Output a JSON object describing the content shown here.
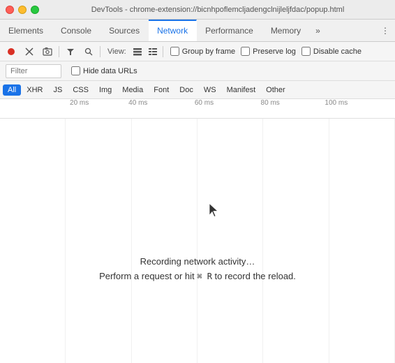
{
  "window": {
    "title": "DevTools - chrome-extension://bicnhpoflemcljadengclnijleljfdac/popup.html",
    "controls": {
      "close": "close",
      "minimize": "minimize",
      "maximize": "maximize"
    }
  },
  "tabs": [
    {
      "id": "elements",
      "label": "Elements",
      "active": false
    },
    {
      "id": "console",
      "label": "Console",
      "active": false
    },
    {
      "id": "sources",
      "label": "Sources",
      "active": false
    },
    {
      "id": "network",
      "label": "Network",
      "active": true
    },
    {
      "id": "performance",
      "label": "Performance",
      "active": false
    },
    {
      "id": "memory",
      "label": "Memory",
      "active": false
    }
  ],
  "toolbar": {
    "view_label": "View:",
    "group_by_frame_label": "Group by frame",
    "preserve_log_label": "Preserve log",
    "disable_cache_label": "Disable cache"
  },
  "filter": {
    "placeholder": "Filter",
    "hide_data_urls_label": "Hide data URLs"
  },
  "type_filters": [
    {
      "id": "all",
      "label": "All",
      "active": true
    },
    {
      "id": "xhr",
      "label": "XHR",
      "active": false
    },
    {
      "id": "js",
      "label": "JS",
      "active": false
    },
    {
      "id": "css",
      "label": "CSS",
      "active": false
    },
    {
      "id": "img",
      "label": "Img",
      "active": false
    },
    {
      "id": "media",
      "label": "Media",
      "active": false
    },
    {
      "id": "font",
      "label": "Font",
      "active": false
    },
    {
      "id": "doc",
      "label": "Doc",
      "active": false
    },
    {
      "id": "ws",
      "label": "WS",
      "active": false
    },
    {
      "id": "manifest",
      "label": "Manifest",
      "active": false
    },
    {
      "id": "other",
      "label": "Other",
      "active": false
    }
  ],
  "timeline": {
    "ticks": [
      "20 ms",
      "40 ms",
      "60 ms",
      "80 ms",
      "100 ms"
    ]
  },
  "main": {
    "recording_text": "Recording network activity…",
    "hint_prefix": "Perform a request or hit ",
    "hint_key": "⌘ R",
    "hint_suffix": " to record the reload."
  }
}
